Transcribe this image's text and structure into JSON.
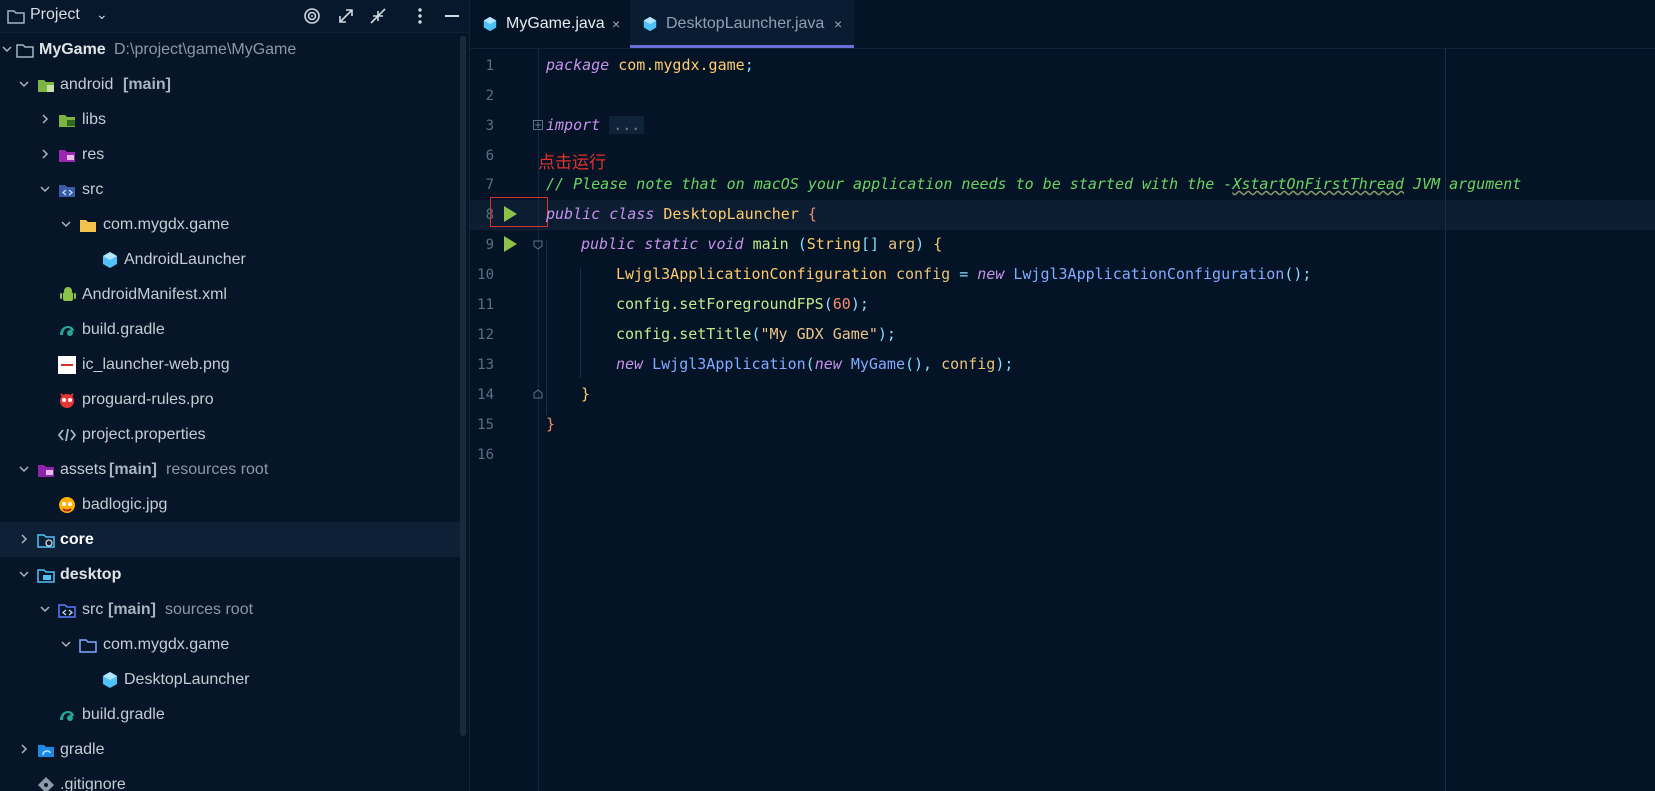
{
  "project_panel": {
    "title": "Project",
    "tree": [
      {
        "label": "MyGame",
        "extra": "D:\\project\\game\\MyGame",
        "icon": "module-folder-icon"
      },
      {
        "label": "android",
        "tag": "[main]",
        "icon": "android-module-icon"
      },
      {
        "label": "libs",
        "icon": "libs-folder-icon"
      },
      {
        "label": "res",
        "icon": "res-folder-icon"
      },
      {
        "label": "src",
        "icon": "source-folder-icon"
      },
      {
        "label": "com.mygdx.game",
        "icon": "package-folder-icon"
      },
      {
        "label": "AndroidLauncher",
        "icon": "java-class-icon"
      },
      {
        "label": "AndroidManifest.xml",
        "icon": "android-manifest-icon"
      },
      {
        "label": "build.gradle",
        "icon": "gradle-icon"
      },
      {
        "label": "ic_launcher-web.png",
        "icon": "image-file-icon"
      },
      {
        "label": "proguard-rules.pro",
        "icon": "proguard-icon"
      },
      {
        "label": "project.properties",
        "icon": "properties-file-icon"
      },
      {
        "label": "assets",
        "tag": "[main]",
        "note": "resources root",
        "icon": "resources-folder-icon"
      },
      {
        "label": "badlogic.jpg",
        "icon": "image-file-icon"
      },
      {
        "label": "core",
        "icon": "core-module-icon"
      },
      {
        "label": "desktop",
        "icon": "desktop-module-icon"
      },
      {
        "label": "src",
        "tag": "[main]",
        "note": "sources root",
        "icon": "source-folder-icon"
      },
      {
        "label": "com.mygdx.game",
        "icon": "package-folder-icon"
      },
      {
        "label": "DesktopLauncher",
        "icon": "java-class-icon"
      },
      {
        "label": "build.gradle",
        "icon": "gradle-icon"
      },
      {
        "label": "gradle",
        "icon": "gradle-folder-icon"
      },
      {
        "label": ".gitignore",
        "icon": "gitignore-icon"
      }
    ]
  },
  "tabs": [
    {
      "label": "MyGame.java",
      "close": "×"
    },
    {
      "label": "DesktopLauncher.java",
      "close": "×"
    }
  ],
  "editor": {
    "line_numbers": [
      "1",
      "2",
      "3",
      "6",
      "7",
      "8",
      "9",
      "10",
      "11",
      "12",
      "13",
      "14",
      "15",
      "16"
    ],
    "annotation": "点击运行",
    "code": {
      "l1_kw": "package",
      "l1_pkg": "com.mygdx.game",
      "l1_semi": ";",
      "l3_kw": "import",
      "l3_fold": "...",
      "l7_comment_a": "// Please note that on macOS your application needs to be started with the -",
      "l7_comment_b": "XstartOnFirstThread",
      "l7_comment_c": " JVM argument",
      "l8_kw": "public class",
      "l8_cls": "DesktopLauncher",
      "l8_br": "{",
      "l9_kw": "public static void",
      "l9_fn": "main",
      "l9_p1": "(",
      "l9_ty": "String",
      "l9_arr": "[]",
      "l9_arg": "arg",
      "l9_p2": ")",
      "l9_br": "{",
      "l10_ty": "Lwjgl3ApplicationConfiguration",
      "l10_var": "config",
      "l10_eq": "=",
      "l10_new": "new",
      "l10_cls": "Lwjgl3ApplicationConfiguration",
      "l10_end": "();",
      "l11_var": "config",
      "l11_fn": ".setForegroundFPS",
      "l11_p1": "(",
      "l11_num": "60",
      "l11_end": ");",
      "l12_var": "config",
      "l12_fn": ".setTitle",
      "l12_p1": "(",
      "l12_str": "\"My GDX Game\"",
      "l12_end": ");",
      "l13_new": "new",
      "l13_cls": "Lwjgl3Application",
      "l13_p1": "(",
      "l13_new2": "new",
      "l13_cls2": "MyGame",
      "l13_p2": "(), ",
      "l13_var": "config",
      "l13_end": ");",
      "l14_br": "}",
      "l15_br": "}"
    }
  }
}
